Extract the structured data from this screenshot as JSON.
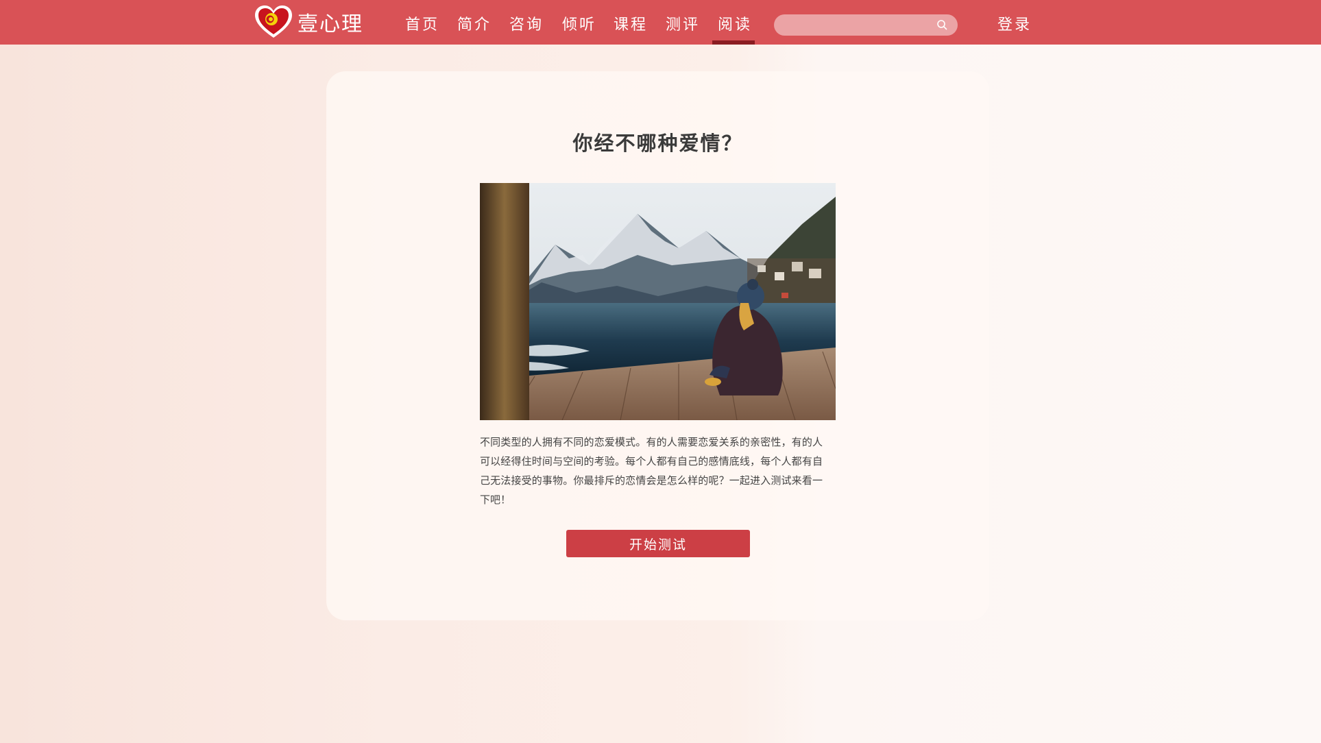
{
  "header": {
    "brand": "壹心理",
    "nav": [
      "首页",
      "简介",
      "咨询",
      "倾听",
      "课程",
      "测评",
      "阅读"
    ],
    "active_nav": "阅读",
    "search_placeholder": "",
    "login": "登录"
  },
  "quiz": {
    "title": "你经不哪种爱情？",
    "description": "不同类型的人拥有不同的恋爱模式。有的人需要恋爱关系的亲密性，有的人可以经得住时间与空间的考验。每个人都有自己的感情底线，每个人都有自己无法接受的事物。你最排斥的恋情会是怎么样的呢？一起进入测试来看一下吧！",
    "start_button": "开始测试"
  },
  "icons": [
    "heart-logo-icon",
    "search-icon"
  ],
  "colors": {
    "navbar": "#d95256",
    "active_indicator": "#8b1d22",
    "button": "#cc3f45"
  }
}
